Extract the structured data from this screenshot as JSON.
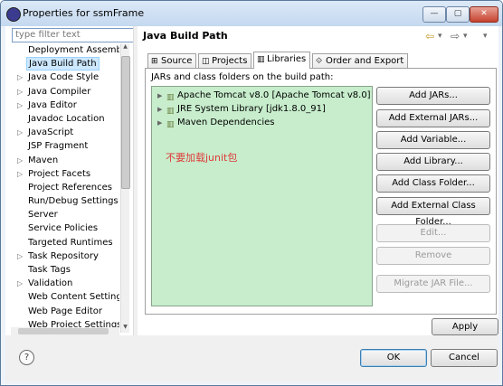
{
  "window": {
    "title": "Properties for ssmFrame",
    "minimize": "—",
    "maximize": "▢",
    "close": "✕"
  },
  "filter": {
    "placeholder": "type filter text"
  },
  "tree": [
    {
      "label": "Deployment Assembl",
      "arrow": "",
      "selected": false
    },
    {
      "label": "Java Build Path",
      "arrow": "",
      "selected": true
    },
    {
      "label": "Java Code Style",
      "arrow": "▷",
      "selected": false
    },
    {
      "label": "Java Compiler",
      "arrow": "▷",
      "selected": false
    },
    {
      "label": "Java Editor",
      "arrow": "▷",
      "selected": false
    },
    {
      "label": "Javadoc Location",
      "arrow": "",
      "selected": false
    },
    {
      "label": "JavaScript",
      "arrow": "▷",
      "selected": false
    },
    {
      "label": "JSP Fragment",
      "arrow": "",
      "selected": false
    },
    {
      "label": "Maven",
      "arrow": "▷",
      "selected": false
    },
    {
      "label": "Project Facets",
      "arrow": "▷",
      "selected": false
    },
    {
      "label": "Project References",
      "arrow": "",
      "selected": false
    },
    {
      "label": "Run/Debug Settings",
      "arrow": "",
      "selected": false
    },
    {
      "label": "Server",
      "arrow": "",
      "selected": false
    },
    {
      "label": "Service Policies",
      "arrow": "",
      "selected": false
    },
    {
      "label": "Targeted Runtimes",
      "arrow": "",
      "selected": false
    },
    {
      "label": "Task Repository",
      "arrow": "▷",
      "selected": false
    },
    {
      "label": "Task Tags",
      "arrow": "",
      "selected": false
    },
    {
      "label": "Validation",
      "arrow": "▷",
      "selected": false
    },
    {
      "label": "Web Content Settings",
      "arrow": "",
      "selected": false
    },
    {
      "label": "Web Page Editor",
      "arrow": "",
      "selected": false
    },
    {
      "label": "Web Project Settings",
      "arrow": "",
      "selected": false
    }
  ],
  "page": {
    "title": "Java Build Path"
  },
  "nav": {
    "back": "⇦",
    "back_menu": "▾",
    "forward": "⇨",
    "forward_menu": "▾",
    "view_menu": "▾"
  },
  "tabs": [
    {
      "label": "Source",
      "icon": "⊞"
    },
    {
      "label": "Projects",
      "icon": "◫"
    },
    {
      "label": "Libraries",
      "icon": "▥"
    },
    {
      "label": "Order and Export",
      "icon": "⟐"
    }
  ],
  "libraries": {
    "heading": "JARs and class folders on the build path:",
    "items": [
      "Apache Tomcat v8.0 [Apache Tomcat v8.0]",
      "JRE System Library [jdk1.8.0_91]",
      "Maven Dependencies"
    ],
    "annotation": "不要加载junit包"
  },
  "buttons": [
    {
      "label": "Add JARs...",
      "enabled": true
    },
    {
      "label": "Add External JARs...",
      "enabled": true
    },
    {
      "label": "Add Variable...",
      "enabled": true
    },
    {
      "label": "Add Library...",
      "enabled": true
    },
    {
      "label": "Add Class Folder...",
      "enabled": true
    },
    {
      "label": "Add External Class Folder...",
      "enabled": true
    },
    {
      "label": "Edit...",
      "enabled": false
    },
    {
      "label": "Remove",
      "enabled": false
    },
    {
      "label": "Migrate JAR File...",
      "enabled": false
    }
  ],
  "apply": "Apply",
  "footer": {
    "help": "?",
    "ok": "OK",
    "cancel": "Cancel"
  }
}
